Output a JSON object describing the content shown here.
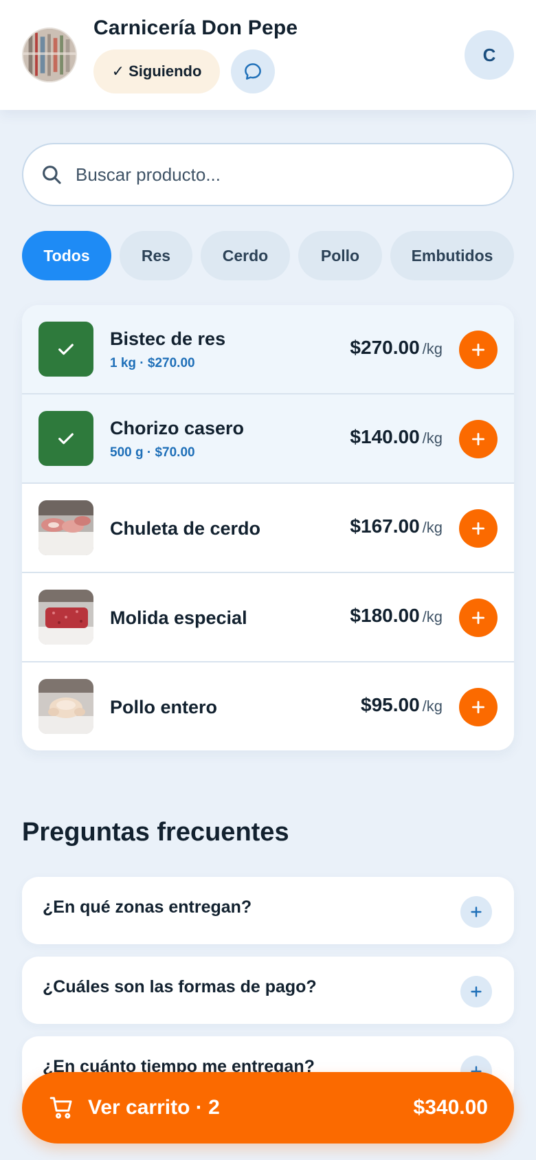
{
  "colors": {
    "accent_blue": "#1e8bf5",
    "accent_orange": "#fb6a00",
    "selected_green": "#2e7a3c",
    "background": "#eaf1f9"
  },
  "header": {
    "store_name": "Carnicería Don Pepe",
    "follow_label": "✓ Siguiendo",
    "user_initial": "C"
  },
  "search": {
    "placeholder": "Buscar producto..."
  },
  "categories": [
    {
      "label": "Todos",
      "active": true
    },
    {
      "label": "Res",
      "active": false
    },
    {
      "label": "Cerdo",
      "active": false
    },
    {
      "label": "Pollo",
      "active": false
    },
    {
      "label": "Embutidos",
      "active": false
    }
  ],
  "products": [
    {
      "name": "Bistec de res",
      "selection": "1 kg · $270.00",
      "price": "$270.00",
      "unit": "/kg",
      "selected": true
    },
    {
      "name": "Chorizo casero",
      "selection": "500 g · $70.00",
      "price": "$140.00",
      "unit": "/kg",
      "selected": true
    },
    {
      "name": "Chuleta de cerdo",
      "price": "$167.00",
      "unit": "/kg",
      "selected": false,
      "icon": "pork-chop-photo"
    },
    {
      "name": "Molida especial",
      "price": "$180.00",
      "unit": "/kg",
      "selected": false,
      "icon": "ground-meat-photo"
    },
    {
      "name": "Pollo entero",
      "price": "$95.00",
      "unit": "/kg",
      "selected": false,
      "icon": "whole-chicken-photo"
    }
  ],
  "faq": {
    "title": "Preguntas frecuentes",
    "items": [
      {
        "question": "¿En qué zonas entregan?"
      },
      {
        "question": "¿Cuáles son las formas de pago?"
      },
      {
        "question": "¿En cuánto tiempo me entregan?"
      }
    ]
  },
  "cart": {
    "label": "Ver carrito · 2",
    "total": "$340.00"
  }
}
